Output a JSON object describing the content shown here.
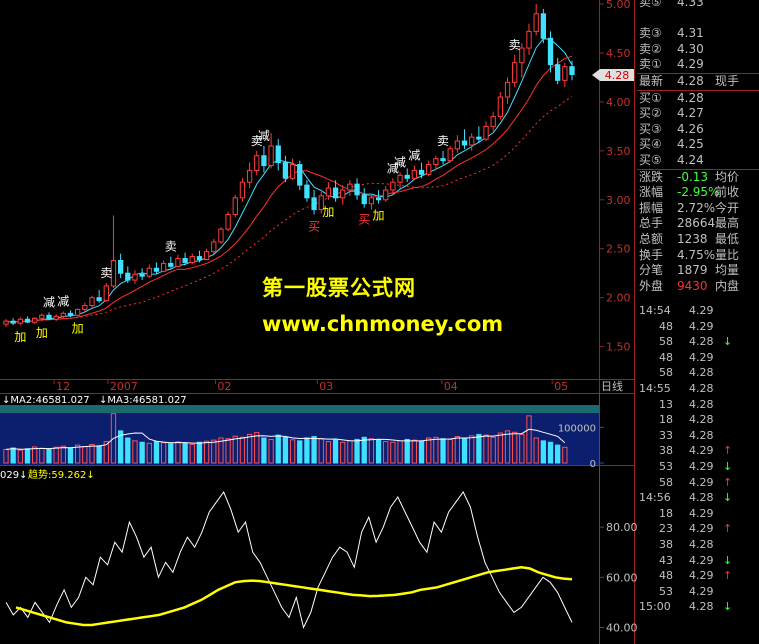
{
  "chart_data": [
    {
      "type": "candlestick",
      "panel": "price",
      "y_ticks": [
        "5.00",
        "4.50",
        "4.00",
        "3.50",
        "3.00",
        "2.50",
        "2.00",
        "1.50"
      ],
      "ylim": [
        1.2,
        5.0
      ],
      "x_labels": [
        "12",
        "2007",
        "02",
        "03",
        "04",
        "05"
      ],
      "period_label": "日线",
      "last_price_tag": "4.28",
      "candles": [
        {
          "o": 1.73,
          "h": 1.78,
          "l": 1.7,
          "c": 1.76
        },
        {
          "o": 1.76,
          "h": 1.79,
          "l": 1.72,
          "c": 1.74
        },
        {
          "o": 1.74,
          "h": 1.8,
          "l": 1.72,
          "c": 1.78
        },
        {
          "o": 1.78,
          "h": 1.81,
          "l": 1.74,
          "c": 1.75
        },
        {
          "o": 1.75,
          "h": 1.8,
          "l": 1.73,
          "c": 1.79
        },
        {
          "o": 1.79,
          "h": 1.84,
          "l": 1.76,
          "c": 1.82
        },
        {
          "o": 1.82,
          "h": 1.85,
          "l": 1.77,
          "c": 1.78
        },
        {
          "o": 1.78,
          "h": 1.83,
          "l": 1.76,
          "c": 1.81
        },
        {
          "o": 1.81,
          "h": 1.86,
          "l": 1.79,
          "c": 1.84
        },
        {
          "o": 1.84,
          "h": 1.87,
          "l": 1.8,
          "c": 1.82
        },
        {
          "o": 1.82,
          "h": 1.89,
          "l": 1.81,
          "c": 1.88
        },
        {
          "o": 1.88,
          "h": 1.95,
          "l": 1.85,
          "c": 1.92
        },
        {
          "o": 1.92,
          "h": 2.02,
          "l": 1.9,
          "c": 2.0
        },
        {
          "o": 2.0,
          "h": 2.08,
          "l": 1.95,
          "c": 1.97
        },
        {
          "o": 1.97,
          "h": 2.15,
          "l": 1.96,
          "c": 2.12
        },
        {
          "o": 2.12,
          "h": 2.84,
          "l": 2.1,
          "c": 2.38
        },
        {
          "o": 2.38,
          "h": 2.45,
          "l": 2.2,
          "c": 2.25
        },
        {
          "o": 2.25,
          "h": 2.32,
          "l": 2.15,
          "c": 2.18
        },
        {
          "o": 2.18,
          "h": 2.28,
          "l": 2.14,
          "c": 2.24
        },
        {
          "o": 2.24,
          "h": 2.3,
          "l": 2.18,
          "c": 2.22
        },
        {
          "o": 2.22,
          "h": 2.34,
          "l": 2.2,
          "c": 2.3
        },
        {
          "o": 2.3,
          "h": 2.36,
          "l": 2.24,
          "c": 2.27
        },
        {
          "o": 2.27,
          "h": 2.38,
          "l": 2.26,
          "c": 2.35
        },
        {
          "o": 2.35,
          "h": 2.42,
          "l": 2.3,
          "c": 2.32
        },
        {
          "o": 2.32,
          "h": 2.44,
          "l": 2.31,
          "c": 2.4
        },
        {
          "o": 2.4,
          "h": 2.46,
          "l": 2.33,
          "c": 2.36
        },
        {
          "o": 2.36,
          "h": 2.45,
          "l": 2.34,
          "c": 2.42
        },
        {
          "o": 2.42,
          "h": 2.48,
          "l": 2.36,
          "c": 2.39
        },
        {
          "o": 2.39,
          "h": 2.5,
          "l": 2.38,
          "c": 2.47
        },
        {
          "o": 2.47,
          "h": 2.6,
          "l": 2.45,
          "c": 2.57
        },
        {
          "o": 2.57,
          "h": 2.72,
          "l": 2.55,
          "c": 2.7
        },
        {
          "o": 2.7,
          "h": 2.88,
          "l": 2.68,
          "c": 2.85
        },
        {
          "o": 2.85,
          "h": 3.05,
          "l": 2.82,
          "c": 3.02
        },
        {
          "o": 3.02,
          "h": 3.22,
          "l": 2.98,
          "c": 3.18
        },
        {
          "o": 3.18,
          "h": 3.38,
          "l": 3.12,
          "c": 3.3
        },
        {
          "o": 3.3,
          "h": 3.5,
          "l": 3.25,
          "c": 3.45
        },
        {
          "o": 3.45,
          "h": 3.55,
          "l": 3.28,
          "c": 3.35
        },
        {
          "o": 3.35,
          "h": 3.68,
          "l": 3.32,
          "c": 3.55
        },
        {
          "o": 3.55,
          "h": 3.62,
          "l": 3.3,
          "c": 3.38
        },
        {
          "o": 3.38,
          "h": 3.45,
          "l": 3.18,
          "c": 3.22
        },
        {
          "o": 3.22,
          "h": 3.42,
          "l": 3.2,
          "c": 3.36
        },
        {
          "o": 3.36,
          "h": 3.4,
          "l": 3.1,
          "c": 3.15
        },
        {
          "o": 3.15,
          "h": 3.2,
          "l": 2.98,
          "c": 3.02
        },
        {
          "o": 3.02,
          "h": 3.1,
          "l": 2.85,
          "c": 2.9
        },
        {
          "o": 2.9,
          "h": 3.08,
          "l": 2.86,
          "c": 3.04
        },
        {
          "o": 3.04,
          "h": 3.18,
          "l": 3.0,
          "c": 3.12
        },
        {
          "o": 3.12,
          "h": 3.2,
          "l": 2.98,
          "c": 3.02
        },
        {
          "o": 3.02,
          "h": 3.15,
          "l": 2.95,
          "c": 3.1
        },
        {
          "o": 3.1,
          "h": 3.2,
          "l": 3.04,
          "c": 3.16
        },
        {
          "o": 3.16,
          "h": 3.22,
          "l": 3.0,
          "c": 3.05
        },
        {
          "o": 3.05,
          "h": 3.12,
          "l": 2.92,
          "c": 2.96
        },
        {
          "o": 2.96,
          "h": 3.06,
          "l": 2.9,
          "c": 3.02
        },
        {
          "o": 3.02,
          "h": 3.1,
          "l": 2.96,
          "c": 3.0
        },
        {
          "o": 3.0,
          "h": 3.14,
          "l": 2.98,
          "c": 3.1
        },
        {
          "o": 3.1,
          "h": 3.22,
          "l": 3.06,
          "c": 3.18
        },
        {
          "o": 3.18,
          "h": 3.28,
          "l": 3.12,
          "c": 3.25
        },
        {
          "o": 3.25,
          "h": 3.32,
          "l": 3.18,
          "c": 3.22
        },
        {
          "o": 3.22,
          "h": 3.35,
          "l": 3.2,
          "c": 3.3
        },
        {
          "o": 3.3,
          "h": 3.38,
          "l": 3.22,
          "c": 3.26
        },
        {
          "o": 3.26,
          "h": 3.4,
          "l": 3.24,
          "c": 3.36
        },
        {
          "o": 3.36,
          "h": 3.45,
          "l": 3.3,
          "c": 3.42
        },
        {
          "o": 3.42,
          "h": 3.5,
          "l": 3.36,
          "c": 3.4
        },
        {
          "o": 3.4,
          "h": 3.55,
          "l": 3.38,
          "c": 3.52
        },
        {
          "o": 3.52,
          "h": 3.66,
          "l": 3.48,
          "c": 3.6
        },
        {
          "o": 3.6,
          "h": 3.72,
          "l": 3.52,
          "c": 3.56
        },
        {
          "o": 3.56,
          "h": 3.68,
          "l": 3.5,
          "c": 3.64
        },
        {
          "o": 3.64,
          "h": 3.75,
          "l": 3.58,
          "c": 3.62
        },
        {
          "o": 3.62,
          "h": 3.8,
          "l": 3.6,
          "c": 3.75
        },
        {
          "o": 3.75,
          "h": 3.9,
          "l": 3.7,
          "c": 3.85
        },
        {
          "o": 3.85,
          "h": 4.1,
          "l": 3.82,
          "c": 4.05
        },
        {
          "o": 4.05,
          "h": 4.25,
          "l": 3.98,
          "c": 4.2
        },
        {
          "o": 4.2,
          "h": 4.48,
          "l": 4.15,
          "c": 4.4
        },
        {
          "o": 4.4,
          "h": 4.6,
          "l": 4.25,
          "c": 4.55
        },
        {
          "o": 4.55,
          "h": 4.8,
          "l": 4.48,
          "c": 4.72
        },
        {
          "o": 4.72,
          "h": 5.0,
          "l": 4.68,
          "c": 4.9
        },
        {
          "o": 4.9,
          "h": 4.95,
          "l": 4.6,
          "c": 4.65
        },
        {
          "o": 4.65,
          "h": 4.72,
          "l": 4.3,
          "c": 4.38
        },
        {
          "o": 4.38,
          "h": 4.45,
          "l": 4.18,
          "c": 4.22
        },
        {
          "o": 4.22,
          "h": 4.4,
          "l": 4.15,
          "c": 4.36
        },
        {
          "o": 4.36,
          "h": 4.42,
          "l": 4.22,
          "c": 4.28
        }
      ],
      "signals": [
        {
          "text": "加",
          "i": 2,
          "pos": "below",
          "color": "#ffff00"
        },
        {
          "text": "加",
          "i": 5,
          "pos": "below",
          "color": "#ffff00"
        },
        {
          "text": "减",
          "i": 6,
          "pos": "above",
          "color": "#ffffff"
        },
        {
          "text": "减",
          "i": 8,
          "pos": "above",
          "color": "#ffffff"
        },
        {
          "text": "加",
          "i": 10,
          "pos": "below",
          "color": "#ffff00"
        },
        {
          "text": "卖",
          "i": 14,
          "pos": "above",
          "color": "#ffffff"
        },
        {
          "text": "卖",
          "i": 23,
          "pos": "above",
          "color": "#ffffff"
        },
        {
          "text": "卖",
          "i": 35,
          "pos": "above",
          "color": "#ffffff"
        },
        {
          "text": "减",
          "i": 36,
          "pos": "above",
          "color": "#ffffff"
        },
        {
          "text": "加",
          "i": 45,
          "pos": "below",
          "color": "#ffff00"
        },
        {
          "text": "买",
          "i": 43,
          "pos": "below",
          "color": "#ff3030"
        },
        {
          "text": "买",
          "i": 50,
          "pos": "below",
          "color": "#ff3030"
        },
        {
          "text": "加",
          "i": 52,
          "pos": "below",
          "color": "#ffff00"
        },
        {
          "text": "减",
          "i": 54,
          "pos": "above",
          "color": "#ffffff"
        },
        {
          "text": "减",
          "i": 55,
          "pos": "above",
          "color": "#ffffff"
        },
        {
          "text": "减",
          "i": 57,
          "pos": "above",
          "color": "#ffffff"
        },
        {
          "text": "卖",
          "i": 61,
          "pos": "above",
          "color": "#ffffff"
        },
        {
          "text": "卖",
          "i": 71,
          "pos": "above",
          "color": "#ffffff"
        }
      ]
    },
    {
      "type": "bar",
      "panel": "volume",
      "legend": [
        "MA2:46581.027",
        "MA3:46581.027"
      ],
      "y_ticks": [
        "100000",
        "0"
      ],
      "ylim": [
        0,
        140000
      ],
      "values": [
        38000,
        42000,
        36000,
        40000,
        45000,
        41000,
        39000,
        44000,
        47000,
        42000,
        50000,
        46000,
        52000,
        48000,
        60000,
        138000,
        90000,
        70000,
        62000,
        58000,
        55000,
        60000,
        57000,
        54000,
        59000,
        56000,
        52000,
        58000,
        61000,
        64000,
        70000,
        68000,
        75000,
        72000,
        80000,
        85000,
        70000,
        66000,
        78000,
        72000,
        65000,
        62000,
        70000,
        74000,
        68000,
        60000,
        64000,
        58000,
        62000,
        66000,
        72000,
        68000,
        64000,
        60000,
        58000,
        62000,
        66000,
        64000,
        60000,
        70000,
        72000,
        68000,
        66000,
        74000,
        70000,
        76000,
        80000,
        78000,
        72000,
        84000,
        90000,
        86000,
        80000,
        132000,
        70000,
        62000,
        58000,
        50000,
        44000
      ]
    },
    {
      "type": "line",
      "panel": "indicator",
      "legend": [
        "029",
        "趋势:59.262"
      ],
      "y_ticks": [
        "80.00",
        "60.00",
        "40.00"
      ],
      "ylim": [
        35,
        98
      ],
      "series": [
        {
          "name": "",
          "color": "#ffffff",
          "values": [
            50,
            45,
            48,
            44,
            50,
            46,
            42,
            49,
            55,
            48,
            52,
            60,
            57,
            68,
            65,
            74,
            70,
            82,
            76,
            68,
            72,
            60,
            66,
            62,
            70,
            76,
            72,
            78,
            86,
            90,
            94,
            87,
            78,
            82,
            70,
            66,
            60,
            54,
            48,
            44,
            52,
            40,
            46,
            56,
            62,
            68,
            72,
            70,
            64,
            78,
            84,
            74,
            80,
            88,
            92,
            86,
            80,
            74,
            70,
            82,
            78,
            86,
            90,
            94,
            88,
            76,
            66,
            60,
            54,
            50,
            46,
            48,
            52,
            56,
            60,
            58,
            54,
            48,
            42
          ]
        },
        {
          "name": "趋势",
          "color": "#ffff00",
          "values": [
            48,
            47,
            46,
            45,
            44,
            43,
            42,
            41.5,
            41,
            41,
            41.5,
            42,
            42.5,
            43,
            43.5,
            44,
            44.5,
            45,
            46,
            47,
            48,
            49.5,
            51,
            53,
            55,
            56.5,
            58,
            58.5,
            58.7,
            58.5,
            58,
            57.5,
            57,
            56.5,
            56,
            55.5,
            55,
            54.5,
            54,
            53.5,
            53,
            52.8,
            52.5,
            52.6,
            52.8,
            53,
            53.5,
            54,
            55,
            55.5,
            56,
            57,
            58,
            59,
            60,
            61,
            62,
            62.5,
            63,
            63.5,
            64,
            63.5,
            62,
            61,
            60,
            59.5,
            59.262
          ]
        }
      ]
    }
  ],
  "quote_panel": {
    "rows": [
      {
        "label": "卖⑤",
        "value": "4.33",
        "extra": ""
      },
      {
        "label": "卖③",
        "value": "4.31",
        "extra": ""
      },
      {
        "label": "卖②",
        "value": "4.30",
        "extra": ""
      },
      {
        "label": "卖①",
        "value": "4.29",
        "extra": ""
      },
      {
        "label": "最新",
        "value": "4.28",
        "extra": "现手"
      },
      {
        "label": "买①",
        "value": "4.28",
        "extra": ""
      },
      {
        "label": "买②",
        "value": "4.27",
        "extra": ""
      },
      {
        "label": "买③",
        "value": "4.26",
        "extra": ""
      },
      {
        "label": "买④",
        "value": "4.25",
        "extra": ""
      },
      {
        "label": "买⑤",
        "value": "4.24",
        "extra": ""
      },
      {
        "label": "涨跌",
        "value": "-0.13",
        "extra": "均价"
      },
      {
        "label": "涨幅",
        "value": "-2.95%",
        "extra": "前收"
      },
      {
        "label": "振幅",
        "value": "2.72%",
        "extra": "今开"
      },
      {
        "label": "总手",
        "value": "28664",
        "extra": "最高"
      },
      {
        "label": "总额",
        "value": "1238",
        "extra": "最低"
      },
      {
        "label": "换手",
        "value": "4.75%",
        "extra": "量比"
      },
      {
        "label": "分笔",
        "value": "1879",
        "extra": "均量"
      },
      {
        "label": "外盘",
        "value": "9430",
        "extra": "内盘"
      }
    ]
  },
  "tick_list": [
    {
      "time": "14:54",
      "price": "4.29",
      "arrow": ""
    },
    {
      "time": "48",
      "price": "4.29",
      "arrow": ""
    },
    {
      "time": "58",
      "price": "4.28",
      "arrow": "↓"
    },
    {
      "time": "48",
      "price": "4.29",
      "arrow": ""
    },
    {
      "time": "58",
      "price": "4.28",
      "arrow": ""
    },
    {
      "time": "14:55",
      "price": "4.28",
      "arrow": ""
    },
    {
      "time": "13",
      "price": "4.28",
      "arrow": ""
    },
    {
      "time": "18",
      "price": "4.28",
      "arrow": ""
    },
    {
      "time": "33",
      "price": "4.28",
      "arrow": ""
    },
    {
      "time": "38",
      "price": "4.29",
      "arrow": "↑"
    },
    {
      "time": "53",
      "price": "4.29",
      "arrow": "↓"
    },
    {
      "time": "58",
      "price": "4.29",
      "arrow": "↑"
    },
    {
      "time": "14:56",
      "price": "4.28",
      "arrow": "↓"
    },
    {
      "time": "18",
      "price": "4.29",
      "arrow": ""
    },
    {
      "time": "23",
      "price": "4.29",
      "arrow": "↑"
    },
    {
      "time": "38",
      "price": "4.28",
      "arrow": ""
    },
    {
      "time": "43",
      "price": "4.29",
      "arrow": "↓"
    },
    {
      "time": "48",
      "price": "4.29",
      "arrow": "↑"
    },
    {
      "time": "53",
      "price": "4.29",
      "arrow": ""
    },
    {
      "time": "15:00",
      "price": "4.28",
      "arrow": "↓"
    }
  ],
  "watermark": {
    "line1": "第一股票公式网",
    "line2": "www.chnmoney.com"
  }
}
